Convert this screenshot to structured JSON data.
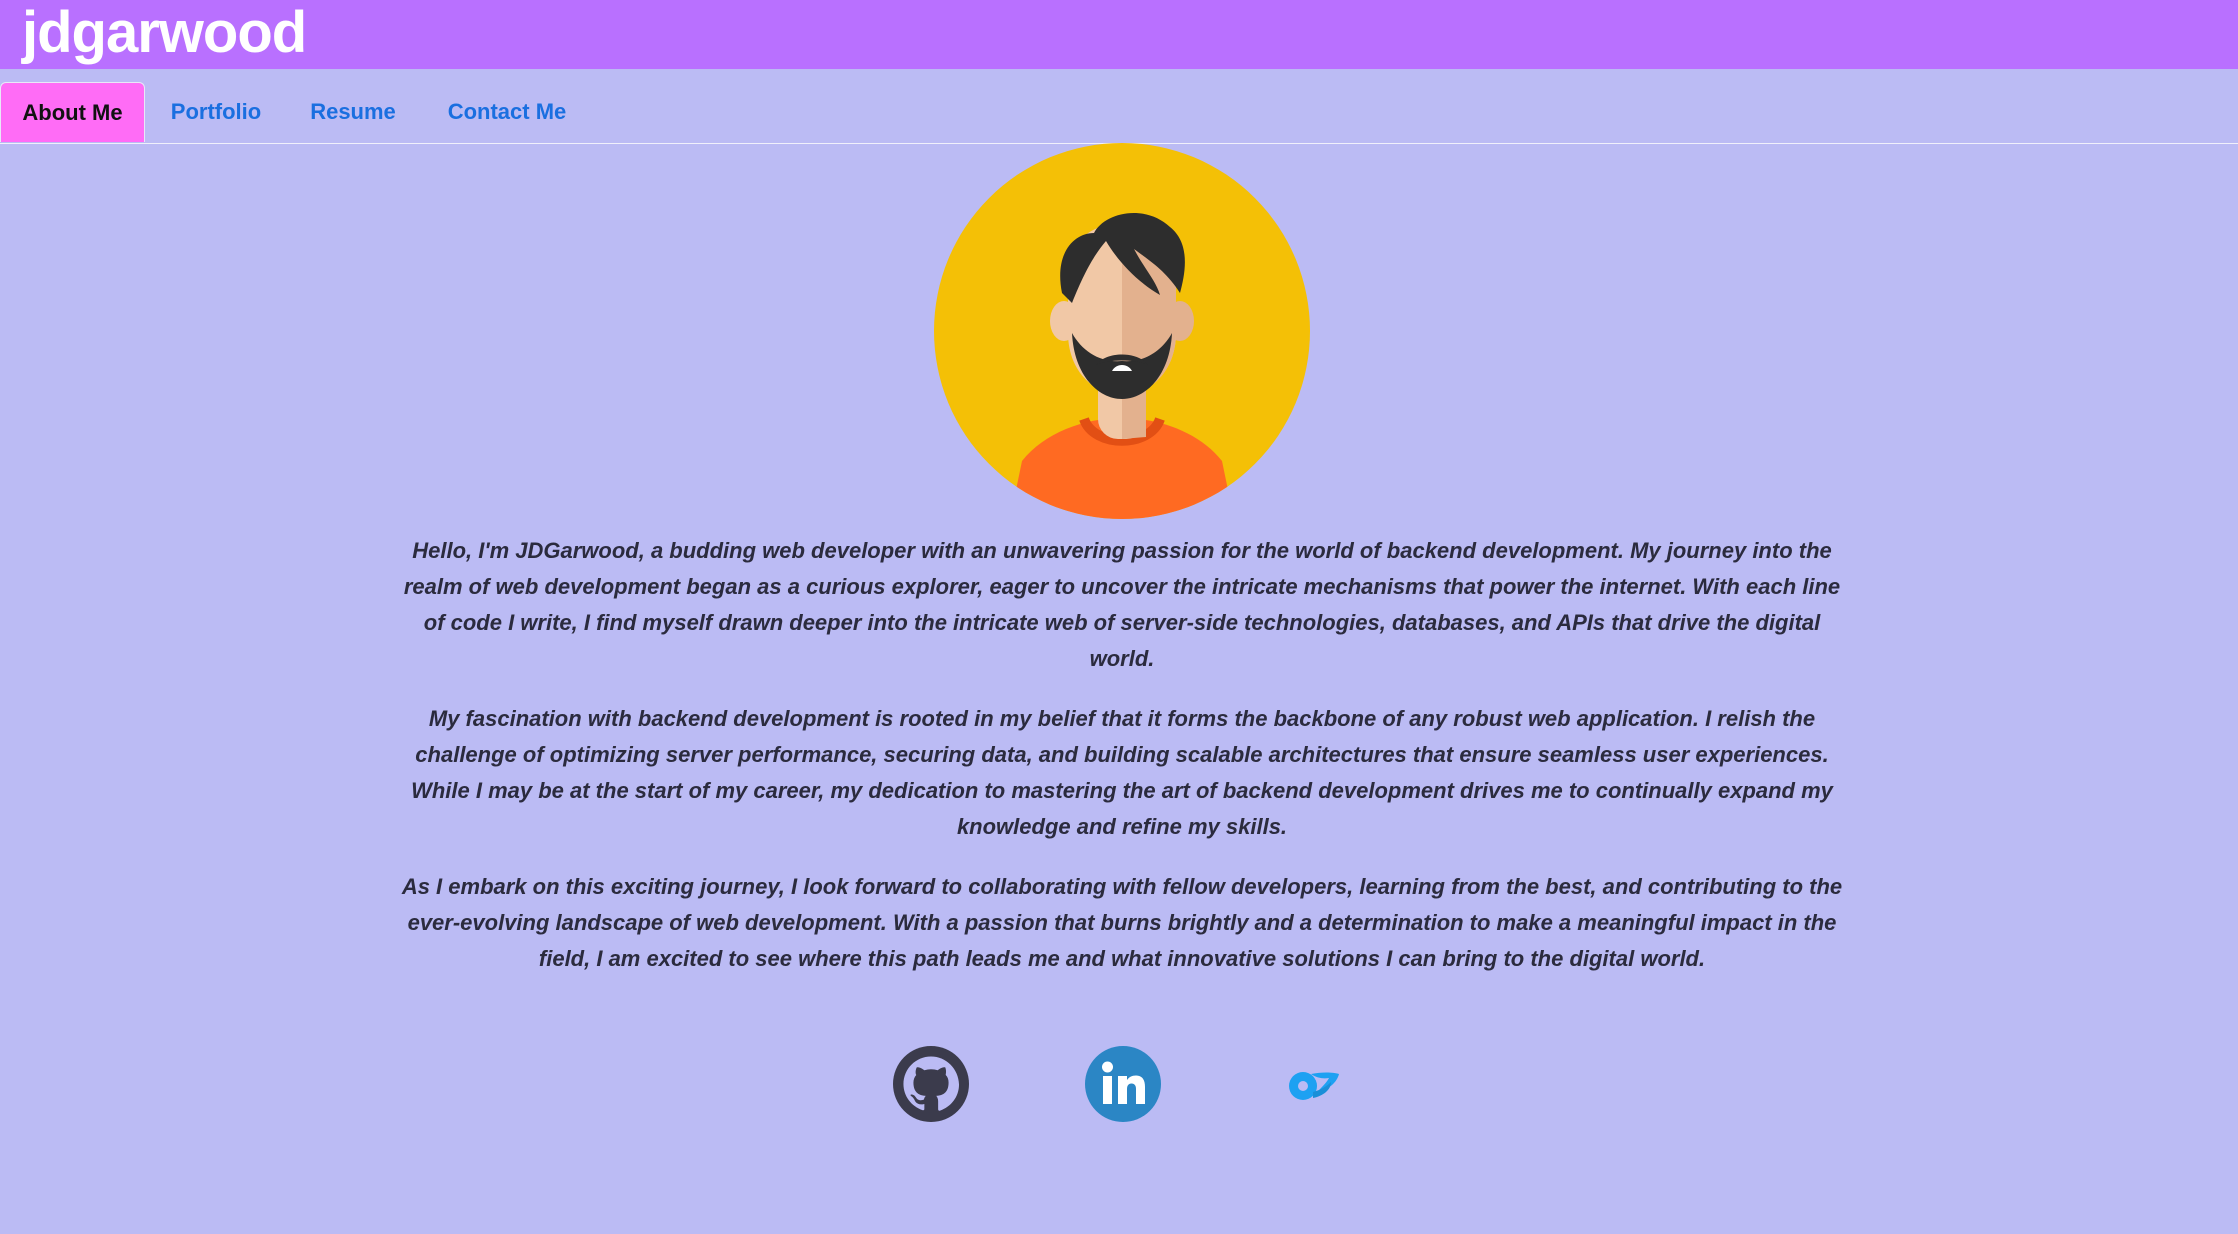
{
  "header": {
    "brand": "jdgarwood"
  },
  "nav": {
    "tabs": [
      {
        "label": "About Me",
        "active": true
      },
      {
        "label": "Portfolio",
        "active": false
      },
      {
        "label": "Resume",
        "active": false
      },
      {
        "label": "Contact Me",
        "active": false
      }
    ]
  },
  "about": {
    "avatar_icon": "bearded-man-avatar-icon",
    "paragraphs": [
      "Hello, I'm JDGarwood, a budding web developer with an unwavering passion for the world of backend development. My journey into the realm of web development began as a curious explorer, eager to uncover the intricate mechanisms that power the internet. With each line of code I write, I find myself drawn deeper into the intricate web of server-side technologies, databases, and APIs that drive the digital world.",
      "My fascination with backend development is rooted in my belief that it forms the backbone of any robust web application. I relish the challenge of optimizing server performance, securing data, and building scalable architectures that ensure seamless user experiences. While I may be at the start of my career, my dedication to mastering the art of backend development drives me to continually expand my knowledge and refine my skills.",
      "As I embark on this exciting journey, I look forward to collaborating with fellow developers, learning from the best, and contributing to the ever-evolving landscape of web development. With a passion that burns brightly and a determination to make a meaningful impact in the field, I am excited to see where this path leads me and what innovative solutions I can bring to the digital world."
    ]
  },
  "social": {
    "links": [
      {
        "icon": "github-icon"
      },
      {
        "icon": "linkedin-icon"
      },
      {
        "icon": "onlyfans-icon"
      }
    ]
  },
  "colors": {
    "topbar": "#b970ff",
    "page_background": "#bbbbf4",
    "active_tab": "#ff6cf6",
    "nav_link": "#1a6fe0",
    "text": "#2b2b3e"
  }
}
